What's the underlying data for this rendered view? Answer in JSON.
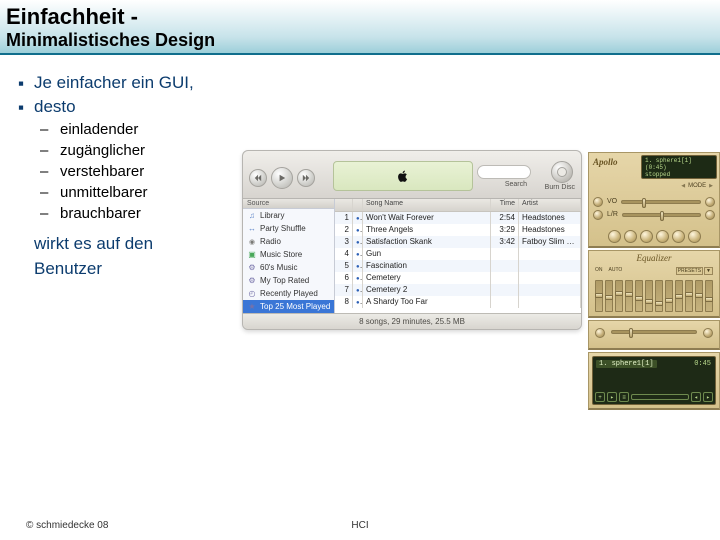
{
  "header": {
    "title": "Einfachheit -",
    "subtitle": "Minimalistisches Design"
  },
  "bullets": {
    "l1": "Je einfacher ein GUI,",
    "l2": "desto"
  },
  "dashes": [
    "einladender",
    "zugänglicher",
    "verstehbarer",
    "unmittelbarer",
    "brauchbarer"
  ],
  "closing": {
    "l1": "wirkt es auf den",
    "l2": "Benutzer"
  },
  "footer": {
    "copyright": "© schmiedecke 08",
    "center": "HCI"
  },
  "itunes": {
    "toolbar": {
      "search_label": "Search",
      "burn_label": "Burn Disc"
    },
    "source_label": "Source",
    "sidebar": [
      {
        "icon": "note",
        "label": "Library"
      },
      {
        "icon": "shuffle",
        "label": "Party Shuffle"
      },
      {
        "icon": "radio",
        "label": "Radio"
      },
      {
        "icon": "store",
        "label": "Music Store"
      },
      {
        "icon": "gear",
        "label": "60's Music"
      },
      {
        "icon": "gear",
        "label": "My Top Rated"
      },
      {
        "icon": "clock",
        "label": "Recently Played"
      },
      {
        "icon": "star",
        "label": "Top 25 Most Played",
        "sel": true
      }
    ],
    "cols": {
      "num": "",
      "name": "Song Name",
      "time": "Time",
      "artist": "Artist"
    },
    "tracks": [
      {
        "n": 1,
        "name": "Won't Wait Forever",
        "time": "2:54",
        "artist": "Headstones"
      },
      {
        "n": 2,
        "name": "Three Angels",
        "time": "3:29",
        "artist": "Headstones"
      },
      {
        "n": 3,
        "name": "Satisfaction Skank",
        "time": "3:42",
        "artist": "Fatboy Slim Vs T..."
      },
      {
        "n": 4,
        "name": "Gun",
        "time": "",
        "artist": ""
      },
      {
        "n": 5,
        "name": "Fascination",
        "time": "",
        "artist": ""
      },
      {
        "n": 6,
        "name": "Cemetery",
        "time": "",
        "artist": ""
      },
      {
        "n": 7,
        "name": "Cemetery 2",
        "time": "",
        "artist": ""
      },
      {
        "n": 8,
        "name": "A Shardy Too Far",
        "time": "",
        "artist": ""
      }
    ],
    "status": "8 songs, 29 minutes, 25.5 MB"
  },
  "gold": {
    "brand": "Apollo",
    "screen": {
      "l1": "1. sphere1[1] (0:45)",
      "l2": "stopped"
    },
    "mode_label": "MODE",
    "row_labels": [
      "VO",
      "L/R"
    ],
    "eq": {
      "title": "Equalizer",
      "on": "ON",
      "auto": "AUTO",
      "presets": [
        "PRESETS",
        "▼"
      ],
      "band_pos": [
        12,
        14,
        10,
        11,
        15,
        18,
        20,
        17,
        13,
        11,
        12,
        16
      ]
    },
    "playlist": {
      "item": "1. sphere1[1]",
      "dur": "0:45"
    }
  }
}
